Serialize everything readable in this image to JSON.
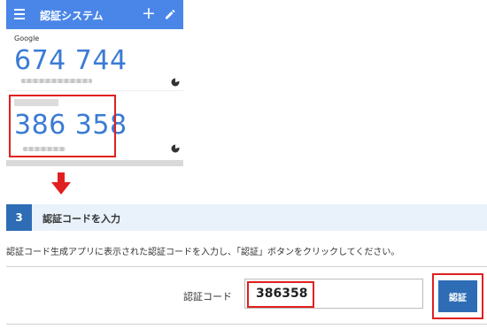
{
  "app": {
    "title": "認証システム",
    "accounts": [
      {
        "label": "Google",
        "code": "674 744"
      },
      {
        "label": "",
        "code": "386 358"
      }
    ]
  },
  "step": {
    "number": "3",
    "title": "認証コードを入力"
  },
  "instruction": "認証コード生成アプリに表示された認証コードを入力し、「認証」ボタンをクリックしてください。",
  "form": {
    "label": "認証コード",
    "value": "386358",
    "submit_label": "認証"
  },
  "colors": {
    "appbar": "#4a86e8",
    "code_text": "#3a7bd5",
    "primary": "#2e6db5",
    "step_bg": "#e9f2fb",
    "highlight": "#e02020"
  },
  "icons": [
    "menu-icon",
    "add-icon",
    "edit-icon",
    "timer-icon",
    "down-arrow-icon"
  ]
}
